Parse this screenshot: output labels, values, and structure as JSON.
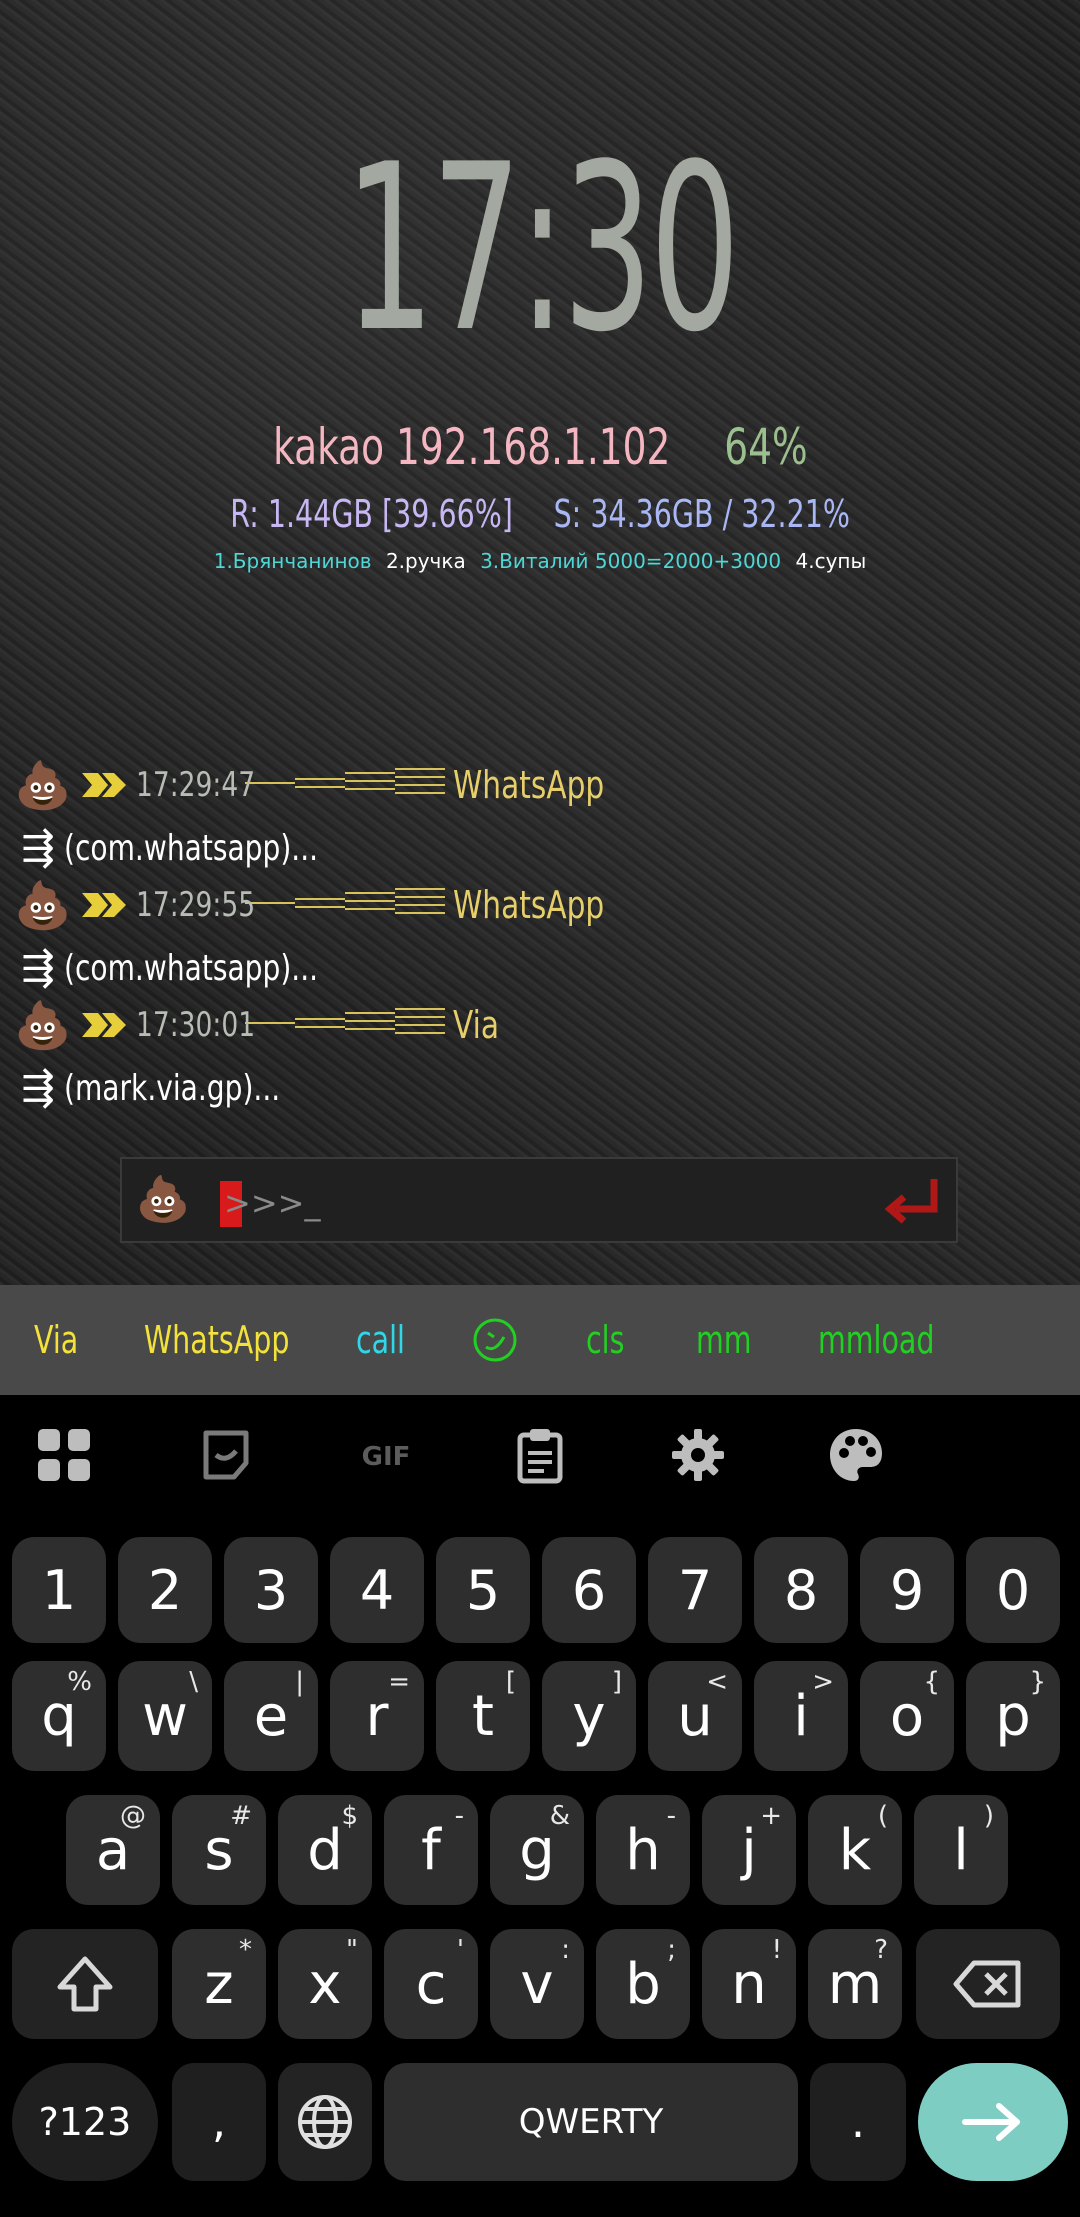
{
  "clock": {
    "time": "17:30"
  },
  "system": {
    "host": "kakao 192.168.1.102",
    "battery": "64%",
    "ram": "R: 1.44GB [39.66%]",
    "storage": "S: 34.36GB / 32.21%",
    "notes": [
      "1.Брянчанинов",
      "2.ручка",
      "3.Виталий 5000=2000+3000",
      "4.супы"
    ]
  },
  "log": [
    {
      "time": "17:29:47",
      "app": "WhatsApp",
      "package": "(com.whatsapp)..."
    },
    {
      "time": "17:29:55",
      "app": "WhatsApp",
      "package": "(com.whatsapp)..."
    },
    {
      "time": "17:30:01",
      "app": "Via",
      "package": "(mark.via.gp)..."
    }
  ],
  "log_icons": {
    "bullet": "poop-emoji",
    "arrow": "double-arrow-icon",
    "package_symbol": "⇶"
  },
  "input": {
    "prompt": ">>>_"
  },
  "suggestions": [
    "Via",
    "WhatsApp",
    "call",
    "cls",
    "mm",
    "mmload"
  ],
  "colors": {
    "clock": "#a3a9a0",
    "host": "#f4b7c1",
    "battery": "#9bbf8f",
    "ram": "#c7b7f2",
    "storage": "#a9b7f4",
    "app_name": "#e6cf6a",
    "accent": "#7ecdc2"
  },
  "keyboard": {
    "numbers": [
      "1",
      "2",
      "3",
      "4",
      "5",
      "6",
      "7",
      "8",
      "9",
      "0"
    ],
    "row1": [
      [
        "q",
        "%"
      ],
      [
        "w",
        "\\"
      ],
      [
        "e",
        "|"
      ],
      [
        "r",
        "="
      ],
      [
        "t",
        "["
      ],
      [
        "y",
        "]"
      ],
      [
        "u",
        "<"
      ],
      [
        "i",
        ">"
      ],
      [
        "o",
        "{"
      ],
      [
        "p",
        "}"
      ]
    ],
    "row2": [
      [
        "a",
        "@"
      ],
      [
        "s",
        "#"
      ],
      [
        "d",
        "$"
      ],
      [
        "f",
        "-"
      ],
      [
        "g",
        "&"
      ],
      [
        "h",
        "-"
      ],
      [
        "j",
        "+"
      ],
      [
        "k",
        "("
      ],
      [
        "l",
        ")"
      ]
    ],
    "row3": [
      [
        "z",
        "*"
      ],
      [
        "x",
        "\""
      ],
      [
        "c",
        "'"
      ],
      [
        "v",
        ":"
      ],
      [
        "b",
        ";"
      ],
      [
        "n",
        "!"
      ],
      [
        "m",
        "?"
      ]
    ],
    "symbols_key": "?123",
    "comma": ",",
    "space": "QWERTY",
    "period": "."
  }
}
